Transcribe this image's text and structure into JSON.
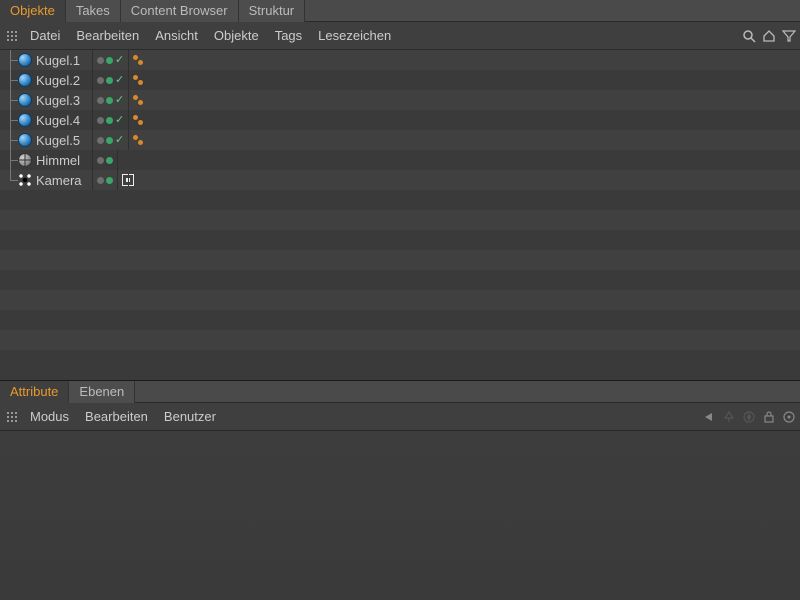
{
  "top": {
    "tabs": [
      "Objekte",
      "Takes",
      "Content Browser",
      "Struktur"
    ],
    "active_tab": 0,
    "menu": [
      "Datei",
      "Bearbeiten",
      "Ansicht",
      "Objekte",
      "Tags",
      "Lesezeichen"
    ]
  },
  "objects": [
    {
      "name": "Kugel.1",
      "icon": "sphere",
      "flags": [
        "grey",
        "green",
        "check"
      ],
      "tags": [
        "orange"
      ]
    },
    {
      "name": "Kugel.2",
      "icon": "sphere",
      "flags": [
        "grey",
        "green",
        "check"
      ],
      "tags": [
        "orange"
      ]
    },
    {
      "name": "Kugel.3",
      "icon": "sphere",
      "flags": [
        "grey",
        "green",
        "check"
      ],
      "tags": [
        "orange"
      ]
    },
    {
      "name": "Kugel.4",
      "icon": "sphere",
      "flags": [
        "grey",
        "green",
        "check"
      ],
      "tags": [
        "orange"
      ]
    },
    {
      "name": "Kugel.5",
      "icon": "sphere",
      "flags": [
        "grey",
        "green",
        "check"
      ],
      "tags": [
        "orange"
      ]
    },
    {
      "name": "Himmel",
      "icon": "sky",
      "flags": [
        "grey",
        "green"
      ],
      "tags": []
    },
    {
      "name": "Kamera",
      "icon": "camera",
      "flags": [
        "grey",
        "green"
      ],
      "tags": [
        "target"
      ]
    }
  ],
  "bottom": {
    "tabs": [
      "Attribute",
      "Ebenen"
    ],
    "active_tab": 0,
    "menu": [
      "Modus",
      "Bearbeiten",
      "Benutzer"
    ]
  },
  "icons": {
    "search": "search-icon",
    "home": "home-icon",
    "funnel": "funnel-icon",
    "nav": "nav-arrow-icon",
    "compass": "compass-icon",
    "lock": "lock-icon",
    "target": "target-icon"
  }
}
